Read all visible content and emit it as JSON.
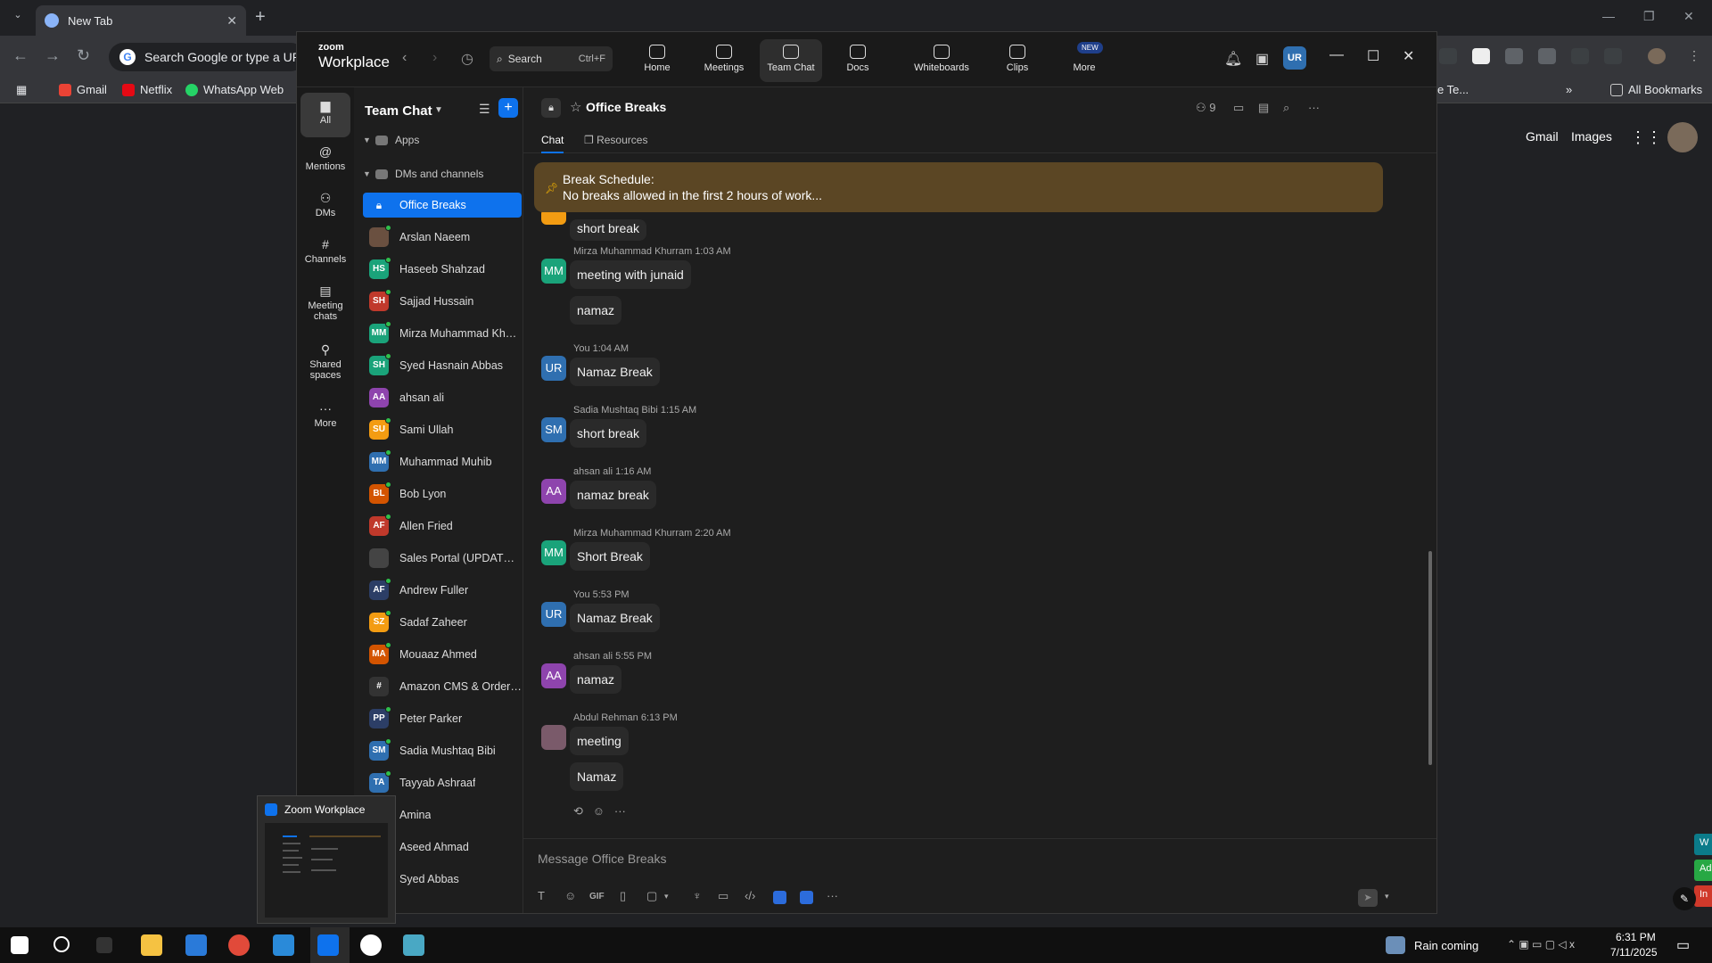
{
  "browser": {
    "tab_title": "New Tab",
    "omnibox_placeholder": "Search Google or type a URL",
    "bookmarks": [
      "Gmail",
      "Netflix",
      "WhatsApp Web"
    ],
    "right_bookmark_frag": "e Te...",
    "all_bookmarks": "All Bookmarks",
    "google_links": [
      "Gmail",
      "Images"
    ],
    "side_tags": [
      "W",
      "Ad",
      "In"
    ]
  },
  "zoom": {
    "logo_top": "zoom",
    "logo_bottom": "Workplace",
    "search_label": "Search",
    "search_shortcut": "Ctrl+F",
    "nav_tabs": [
      "Home",
      "Meetings",
      "Team Chat",
      "Docs",
      "Whiteboards",
      "Clips",
      "More"
    ],
    "new_badge": "NEW",
    "avatar_initials": "UR",
    "rail": [
      "All",
      "Mentions",
      "DMs",
      "Channels",
      "Meeting chats",
      "Shared spaces",
      "More"
    ],
    "list_title": "Team Chat",
    "sections": {
      "apps": "Apps",
      "dms": "DMs and channels"
    },
    "contacts": [
      {
        "name": "Office Breaks",
        "initials": "",
        "color": "#0e72ed"
      },
      {
        "name": "Arslan Naeem",
        "initials": "",
        "color": "#6a5040"
      },
      {
        "name": "Haseeb Shahzad",
        "initials": "HS",
        "color": "#1aa37a"
      },
      {
        "name": "Sajjad Hussain",
        "initials": "SH",
        "color": "#c0392b"
      },
      {
        "name": "Mirza Muhammad Khurram",
        "initials": "MM",
        "color": "#1aa37a"
      },
      {
        "name": "Syed Hasnain Abbas",
        "initials": "SH",
        "color": "#1aa37a"
      },
      {
        "name": "ahsan ali",
        "initials": "AA",
        "color": "#8e44ad"
      },
      {
        "name": "Sami Ullah",
        "initials": "SU",
        "color": "#f39c12"
      },
      {
        "name": "Muhammad Muhib",
        "initials": "MM",
        "color": "#2f6fb0"
      },
      {
        "name": "Bob Lyon",
        "initials": "BL",
        "color": "#d35400"
      },
      {
        "name": "Allen Fried",
        "initials": "AF",
        "color": "#c0392b"
      },
      {
        "name": "Sales Portal (UPDATES)",
        "initials": "",
        "color": "#444"
      },
      {
        "name": "Andrew Fuller",
        "initials": "AF",
        "color": "#2c3e66"
      },
      {
        "name": "Sadaf Zaheer",
        "initials": "SZ",
        "color": "#f39c12"
      },
      {
        "name": "Mouaaz Ahmed",
        "initials": "MA",
        "color": "#d35400"
      },
      {
        "name": "Amazon CMS & OrderAuto...",
        "initials": "#",
        "color": "#333"
      },
      {
        "name": "Peter Parker",
        "initials": "PP",
        "color": "#2c3e66"
      },
      {
        "name": "Sadia Mushtaq Bibi",
        "initials": "SM",
        "color": "#2f6fb0"
      },
      {
        "name": "Tayyab Ashraaf",
        "initials": "TA",
        "color": "#2f6fb0"
      },
      {
        "name": "Amina",
        "initials": "",
        "color": "#444"
      },
      {
        "name": "Aseed Ahmad",
        "initials": "",
        "color": "#444"
      },
      {
        "name": "Syed Abbas",
        "initials": "",
        "color": "#444"
      }
    ],
    "channel": {
      "title": "Office Breaks",
      "member_count": "9",
      "tabs": [
        "Chat",
        "Resources"
      ],
      "pinned_title": "Break Schedule:",
      "pinned_text": "No breaks allowed in the first 2 hours of work...",
      "partial_bubble": "short break",
      "messages": [
        {
          "author": "Mirza Muhammad Khurram 1:03 AM",
          "initials": "MM",
          "color": "#1aa37a",
          "bubbles": [
            "meeting with junaid",
            "namaz"
          ]
        },
        {
          "author": "You 1:04 AM",
          "initials": "UR",
          "color": "#2f6fb0",
          "bubbles": [
            "Namaz Break"
          ]
        },
        {
          "author": "Sadia Mushtaq Bibi 1:15 AM",
          "initials": "SM",
          "color": "#2f6fb0",
          "bubbles": [
            "short break"
          ]
        },
        {
          "author": "ahsan ali 1:16 AM",
          "initials": "AA",
          "color": "#8e44ad",
          "bubbles": [
            "namaz break"
          ]
        },
        {
          "author": "Mirza Muhammad Khurram 2:20 AM",
          "initials": "MM",
          "color": "#1aa37a",
          "bubbles": [
            "Short Break"
          ]
        },
        {
          "author": "You 5:53 PM",
          "initials": "UR",
          "color": "#2f6fb0",
          "bubbles": [
            "Namaz Break"
          ]
        },
        {
          "author": "ahsan ali 5:55 PM",
          "initials": "AA",
          "color": "#8e44ad",
          "bubbles": [
            "namaz"
          ]
        },
        {
          "author": "Abdul Rehman 6:13 PM",
          "initials": "",
          "color": "#7a5a6a",
          "bubbles": [
            "meeting",
            "Namaz"
          ]
        }
      ],
      "composer_placeholder": "Message Office Breaks"
    }
  },
  "thumbnail_title": "Zoom Workplace",
  "taskbar": {
    "weather": "Rain coming",
    "time": "6:31 PM",
    "date": "7/11/2025"
  }
}
